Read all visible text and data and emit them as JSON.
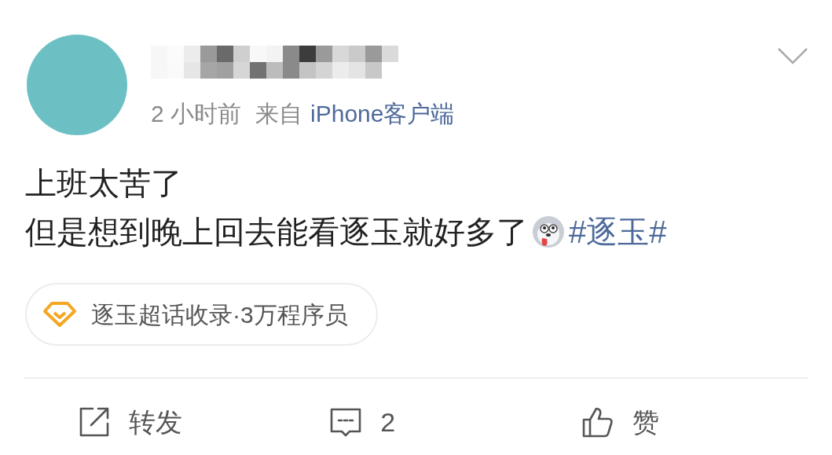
{
  "post": {
    "time": "2 小时前",
    "source_prefix": "来自",
    "source": "iPhone客户端",
    "lines": [
      {
        "text": "上班太苦了"
      },
      {
        "text": "但是想到晚上回去能看逐玉就好多了",
        "hashtag": "#逐玉#"
      }
    ],
    "topic": {
      "name": "逐玉超话收录",
      "members": "·3万程序员"
    }
  },
  "actions": [
    {
      "kind": "repost",
      "label": "转发"
    },
    {
      "kind": "comment",
      "label": "2"
    },
    {
      "kind": "like",
      "label": "赞"
    }
  ]
}
